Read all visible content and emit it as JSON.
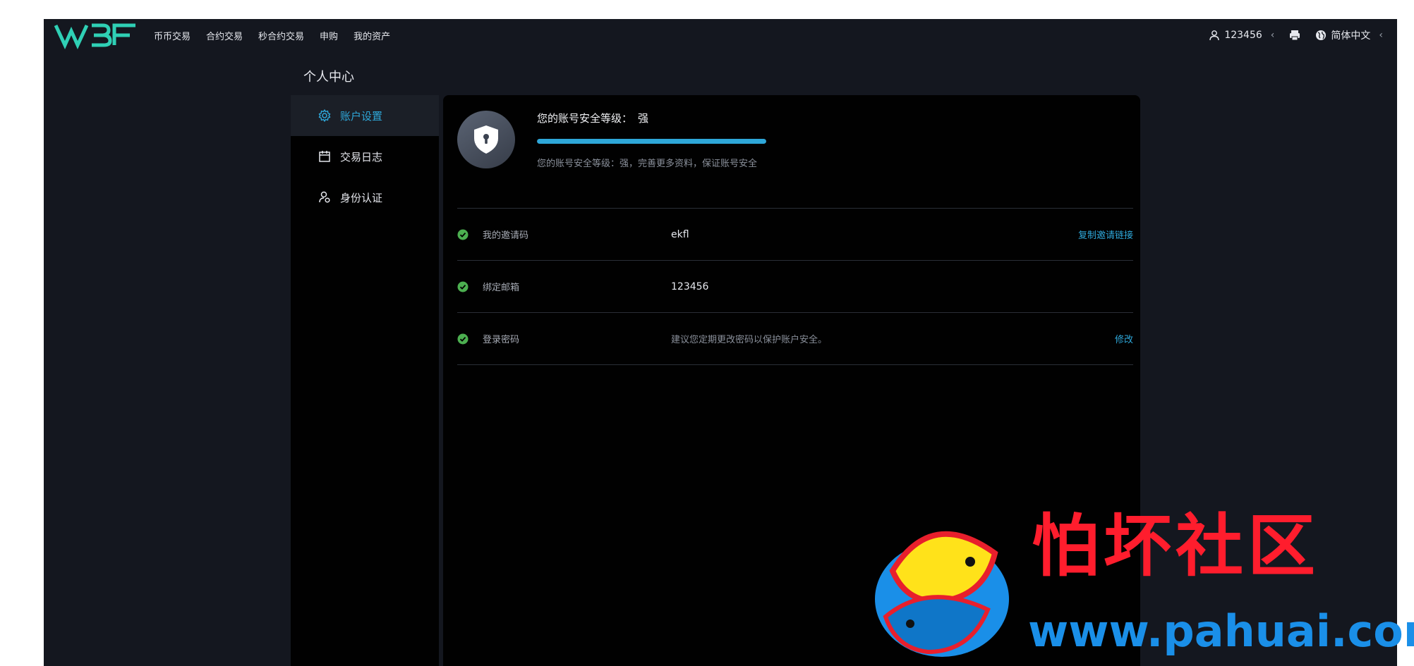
{
  "header": {
    "logo_text": "WBF",
    "nav": [
      "币币交易",
      "合约交易",
      "秒合约交易",
      "申购",
      "我的资产"
    ],
    "user": "123456",
    "language": "简体中文"
  },
  "page_title": "个人中心",
  "sidebar": {
    "items": [
      {
        "label": "账户设置",
        "active": true
      },
      {
        "label": "交易日志",
        "active": false
      },
      {
        "label": "身份认证",
        "active": false
      }
    ]
  },
  "security": {
    "title": "您的账号安全等级：",
    "level": "强",
    "progress": 1.0,
    "hint": "您的账号安全等级：强，完善更多资料，保证账号安全"
  },
  "rows": [
    {
      "label": "我的邀请码",
      "value": "ekfl",
      "action": "复制邀请链接"
    },
    {
      "label": "绑定邮箱",
      "value": "123456",
      "action": ""
    },
    {
      "label": "登录密码",
      "value": "建议您定期更改密码以保护账户安全。",
      "action": "修改"
    }
  ],
  "watermark": {
    "title": "怕坏社区",
    "url": "www.pahuai.com"
  },
  "colors": {
    "accent": "#2ea7d9",
    "success": "#4caf50",
    "background": "#14171f",
    "panel": "#010101"
  }
}
